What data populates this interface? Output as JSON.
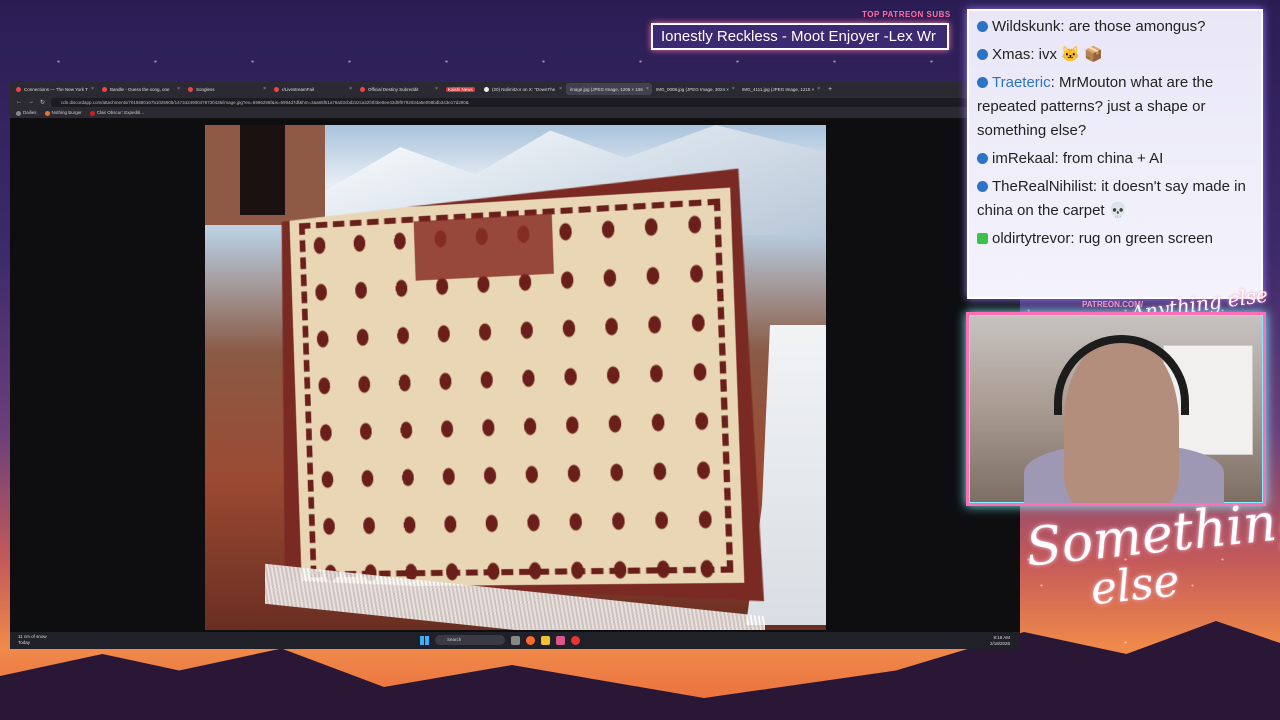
{
  "overlay": {
    "patreon_label": "TOP PATREON SUBS",
    "patreon_names": "Ionestly Reckless - Moot Enjoyer -Lex Wr",
    "patreon_url": "PATREON.COM/",
    "logo_line1": "Something",
    "logo_line2": "else",
    "anything_else": "Anything else"
  },
  "browser": {
    "tabs": [
      {
        "label": "Connections — The New York T"
      },
      {
        "label": "Bandle - Guess the song, one"
      },
      {
        "label": "Songless"
      },
      {
        "label": "r/LivestreamFail"
      },
      {
        "label": "Official Destiny Subreddit"
      },
      {
        "label": "Kalshi News",
        "badge": true
      },
      {
        "label": "(20) Nolimitzor on X: \"DownThe"
      },
      {
        "label": "image.jpg (JPEG Image, 1206 × 156",
        "active": true
      },
      {
        "label": "IMG_0008.jpg (JPEG Image, 3024 ×"
      },
      {
        "label": "IMG_4111.jpg (JPEG Image, 1215 ×"
      }
    ],
    "url": "cdn.discordapp.com/attachments/701568016751025905/1473424900478730435/image.jpg?ex=6996295f&is=6994d7df&hm=3aa65f51a76a03cbd222ca32f4f4be8ee43d9f0792034a5e058bdb343e17d290&",
    "zoom": "30%",
    "bookmarks": [
      "Dailies",
      "Nothing Burger",
      "Clair Obscur: Expediti..."
    ]
  },
  "taskbar": {
    "weather_line1": "11 cm of snow",
    "weather_line2": "Today",
    "search_placeholder": "Search",
    "time": "8:18 AM",
    "date": "2/18/2026"
  },
  "chat": {
    "messages": [
      {
        "user": "Wildskunk",
        "text": ": are those amongus?",
        "badge": "blue"
      },
      {
        "user": "Xmas",
        "text": ": ivx 🐱 📦",
        "badge": "blue"
      },
      {
        "user": "Traeteric",
        "text": ": MrMouton what are the repeated patterns? just a shape or something else?",
        "badge": "blue"
      },
      {
        "user": "imRekaal",
        "text": ": from china + AI",
        "badge": "blue"
      },
      {
        "user": "TheRealNihilist",
        "text": ": it doesn't say made in china on the carpet 💀",
        "badge": "blue"
      },
      {
        "user": "oldirtytrevor",
        "text": ": rug on green screen",
        "badge": "green"
      }
    ],
    "colors": {
      "traeteric": "#2a73c9",
      "default": "#222222"
    }
  }
}
